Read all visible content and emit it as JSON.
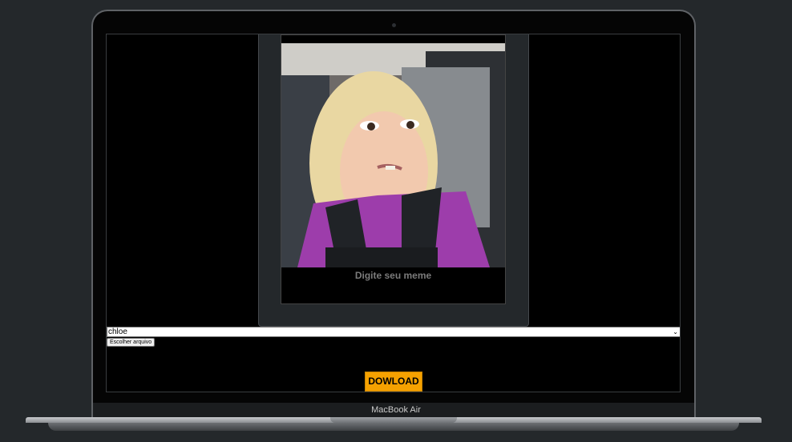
{
  "meme": {
    "caption_placeholder": "Digite seu meme",
    "photo_icon": "meme-photo"
  },
  "controls": {
    "template_selected": "chloe",
    "file_button_label": "Escolher arquivo",
    "download_label": "DOWLOAD"
  },
  "device": {
    "brand_label": "MacBook Air"
  },
  "colors": {
    "page_bg": "#24282b",
    "download_bg": "#f5a100",
    "screen_bg": "#000000"
  }
}
